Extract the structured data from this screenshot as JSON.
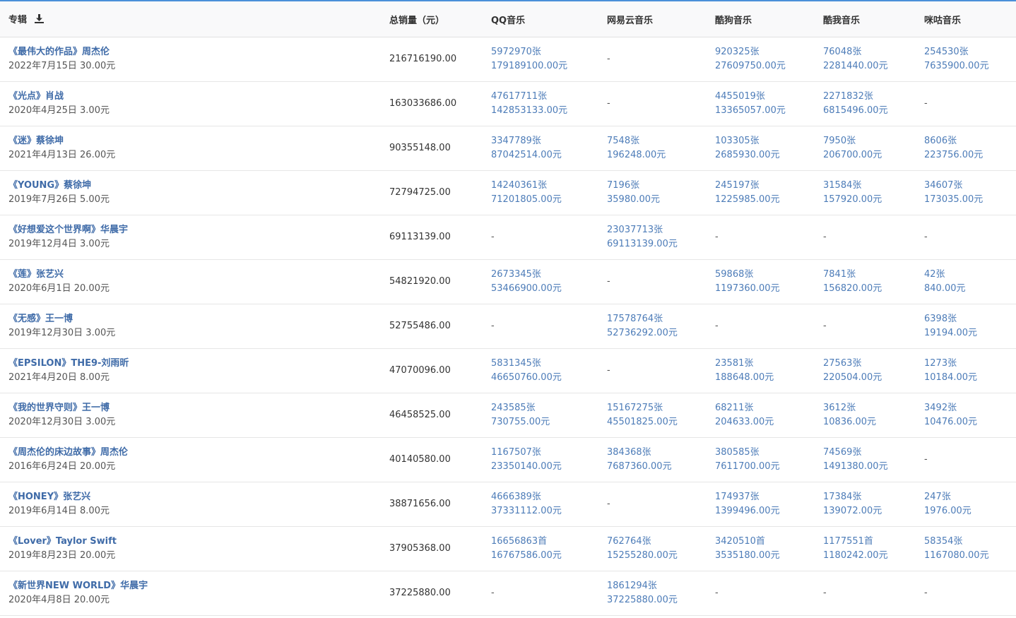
{
  "header": {
    "album": "专辑",
    "total": "总销量（元）",
    "qq": "QQ音乐",
    "wy": "网易云音乐",
    "kg": "酷狗音乐",
    "kw": "酷我音乐",
    "mg": "咪咕音乐"
  },
  "rows": [
    {
      "title": "《最伟大的作品》周杰伦",
      "sub": "2022年7月15日  30.00元",
      "total": "216716190.00",
      "qq": [
        "5972970张",
        "179189100.00元"
      ],
      "wy": "-",
      "kg": [
        "920325张",
        "27609750.00元"
      ],
      "kw": [
        "76048张",
        "2281440.00元"
      ],
      "mg": [
        "254530张",
        "7635900.00元"
      ]
    },
    {
      "title": "《光点》肖战",
      "sub": "2020年4月25日  3.00元",
      "total": "163033686.00",
      "qq": [
        "47617711张",
        "142853133.00元"
      ],
      "wy": "-",
      "kg": [
        "4455019张",
        "13365057.00元"
      ],
      "kw": [
        "2271832张",
        "6815496.00元"
      ],
      "mg": "-"
    },
    {
      "title": "《迷》蔡徐坤",
      "sub": "2021年4月13日  26.00元",
      "total": "90355148.00",
      "qq": [
        "3347789张",
        "87042514.00元"
      ],
      "wy": [
        "7548张",
        "196248.00元"
      ],
      "kg": [
        "103305张",
        "2685930.00元"
      ],
      "kw": [
        "7950张",
        "206700.00元"
      ],
      "mg": [
        "8606张",
        "223756.00元"
      ]
    },
    {
      "title": "《YOUNG》蔡徐坤",
      "sub": "2019年7月26日  5.00元",
      "total": "72794725.00",
      "qq": [
        "14240361张",
        "71201805.00元"
      ],
      "wy": [
        "7196张",
        "35980.00元"
      ],
      "kg": [
        "245197张",
        "1225985.00元"
      ],
      "kw": [
        "31584张",
        "157920.00元"
      ],
      "mg": [
        "34607张",
        "173035.00元"
      ]
    },
    {
      "title": "《好想爱这个世界啊》华晨宇",
      "sub": "2019年12月4日  3.00元",
      "total": "69113139.00",
      "qq": "-",
      "wy": [
        "23037713张",
        "69113139.00元"
      ],
      "kg": "-",
      "kw": "-",
      "mg": "-"
    },
    {
      "title": "《莲》张艺兴",
      "sub": "2020年6月1日  20.00元",
      "total": "54821920.00",
      "qq": [
        "2673345张",
        "53466900.00元"
      ],
      "wy": "-",
      "kg": [
        "59868张",
        "1197360.00元"
      ],
      "kw": [
        "7841张",
        "156820.00元"
      ],
      "mg": [
        "42张",
        "840.00元"
      ]
    },
    {
      "title": "《无感》王一博",
      "sub": "2019年12月30日  3.00元",
      "total": "52755486.00",
      "qq": "-",
      "wy": [
        "17578764张",
        "52736292.00元"
      ],
      "kg": "-",
      "kw": "-",
      "mg": [
        "6398张",
        "19194.00元"
      ]
    },
    {
      "title": "《EPSILON》THE9-刘雨昕",
      "sub": "2021年4月20日  8.00元",
      "total": "47070096.00",
      "qq": [
        "5831345张",
        "46650760.00元"
      ],
      "wy": "-",
      "kg": [
        "23581张",
        "188648.00元"
      ],
      "kw": [
        "27563张",
        "220504.00元"
      ],
      "mg": [
        "1273张",
        "10184.00元"
      ]
    },
    {
      "title": "《我的世界守则》王一博",
      "sub": "2020年12月30日  3.00元",
      "total": "46458525.00",
      "qq": [
        "243585张",
        "730755.00元"
      ],
      "wy": [
        "15167275张",
        "45501825.00元"
      ],
      "kg": [
        "68211张",
        "204633.00元"
      ],
      "kw": [
        "3612张",
        "10836.00元"
      ],
      "mg": [
        "3492张",
        "10476.00元"
      ]
    },
    {
      "title": "《周杰伦的床边故事》周杰伦",
      "sub": "2016年6月24日  20.00元",
      "total": "40140580.00",
      "qq": [
        "1167507张",
        "23350140.00元"
      ],
      "wy": [
        "384368张",
        "7687360.00元"
      ],
      "kg": [
        "380585张",
        "7611700.00元"
      ],
      "kw": [
        "74569张",
        "1491380.00元"
      ],
      "mg": "-"
    },
    {
      "title": "《HONEY》张艺兴",
      "sub": "2019年6月14日  8.00元",
      "total": "38871656.00",
      "qq": [
        "4666389张",
        "37331112.00元"
      ],
      "wy": "-",
      "kg": [
        "174937张",
        "1399496.00元"
      ],
      "kw": [
        "17384张",
        "139072.00元"
      ],
      "mg": [
        "247张",
        "1976.00元"
      ]
    },
    {
      "title": "《Lover》Taylor Swift",
      "sub": "2019年8月23日  20.00元",
      "total": "37905368.00",
      "qq": [
        "16656863首",
        "16767586.00元"
      ],
      "wy": [
        "762764张",
        "15255280.00元"
      ],
      "kg": [
        "3420510首",
        "3535180.00元"
      ],
      "kw": [
        "1177551首",
        "1180242.00元"
      ],
      "mg": [
        "58354张",
        "1167080.00元"
      ]
    },
    {
      "title": "《新世界NEW WORLD》华晨宇",
      "sub": "2020年4月8日  20.00元",
      "total": "37225880.00",
      "qq": "-",
      "wy": [
        "1861294张",
        "37225880.00元"
      ],
      "kg": "-",
      "kw": "-",
      "mg": "-"
    }
  ],
  "icons": {
    "download": "download-icon"
  },
  "colors": {
    "link": "#3f6ba8",
    "platform": "#4d7cb8",
    "accent": "#4a90d9"
  }
}
